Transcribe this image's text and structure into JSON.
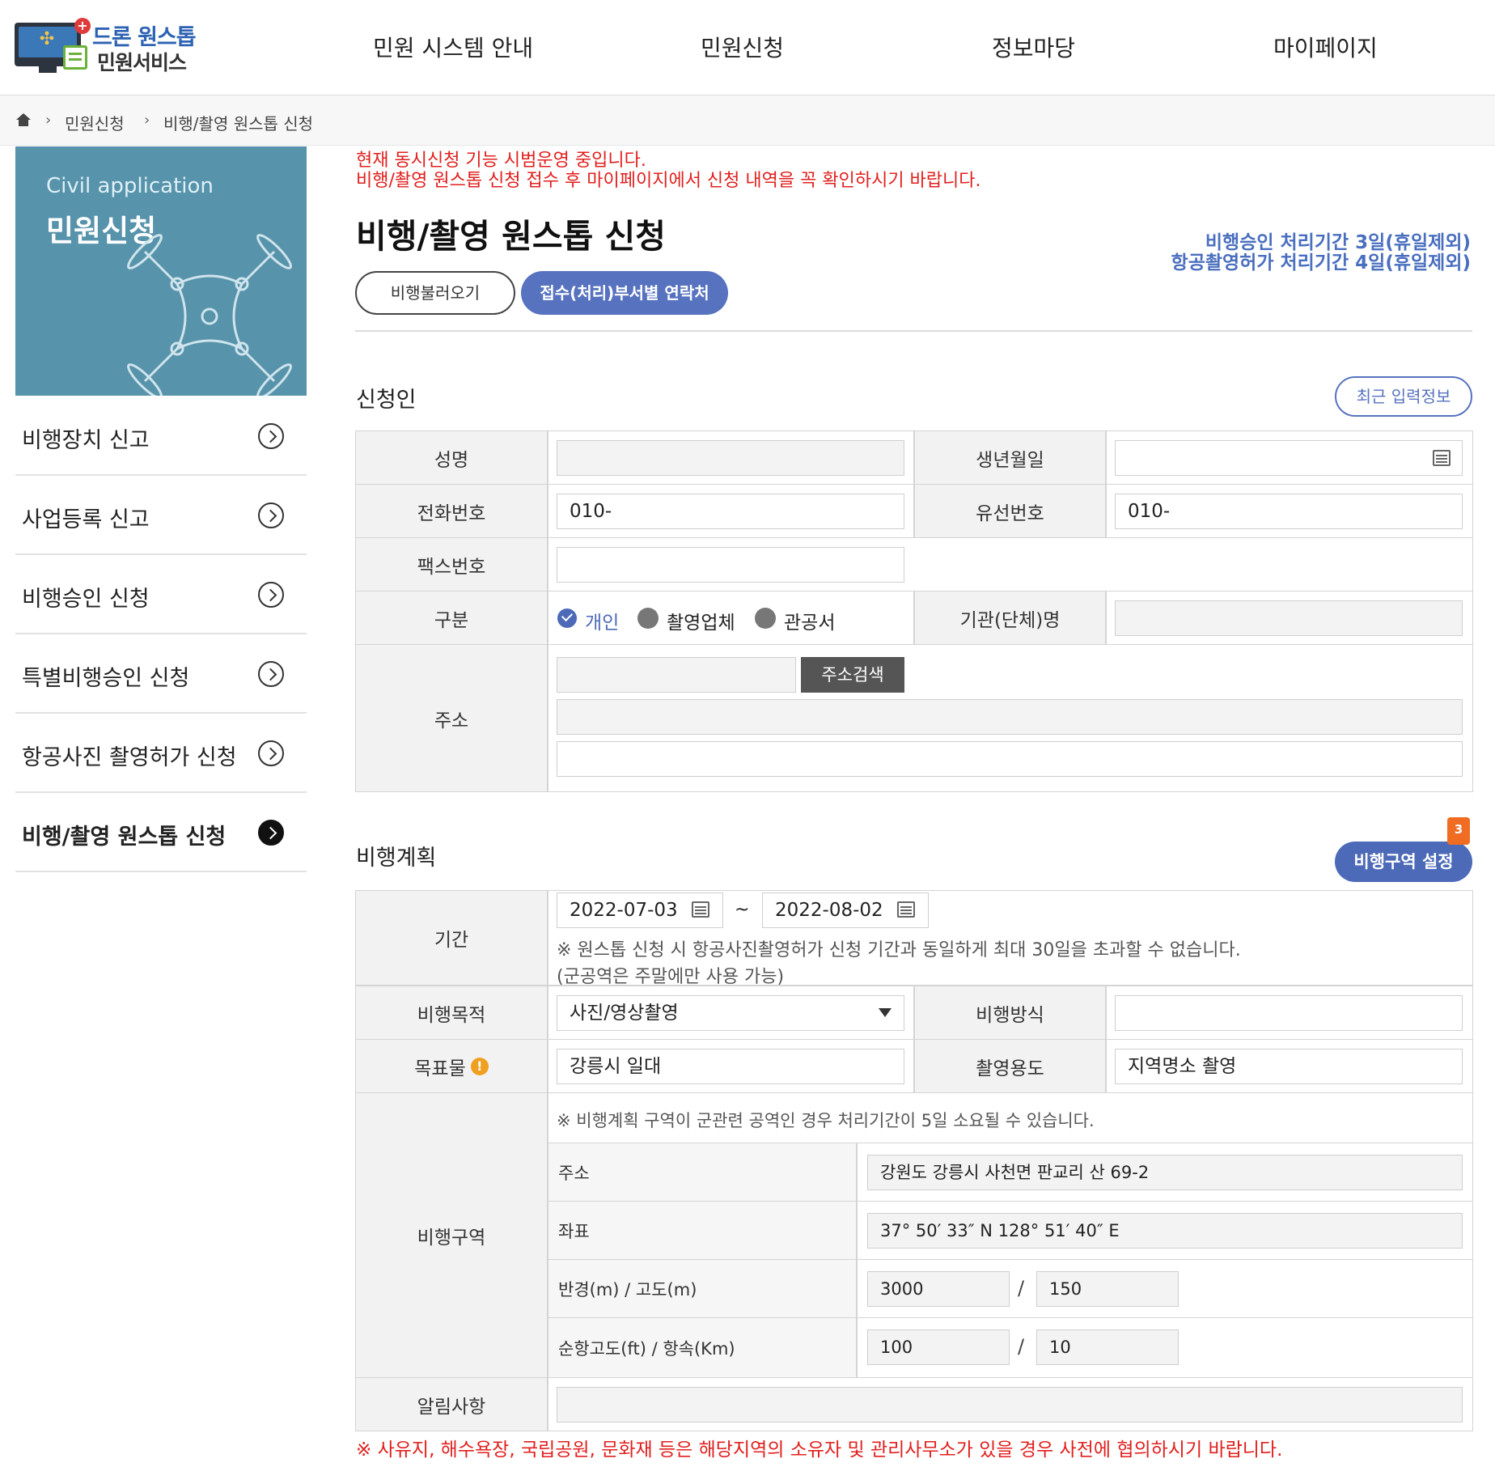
{
  "header": {
    "logo_line1": "드론 원스톱",
    "logo_line2": "민원서비스",
    "nav": [
      "민원 시스템 안내",
      "민원신청",
      "정보마당",
      "마이페이지"
    ]
  },
  "breadcrumb": [
    "민원신청",
    "비행/촬영 원스톱 신청"
  ],
  "sidebar": {
    "banner_en": "Civil application",
    "banner_kr": "민원신청",
    "items": [
      {
        "label": "비행장치 신고"
      },
      {
        "label": "사업등록 신고"
      },
      {
        "label": "비행승인 신청"
      },
      {
        "label": "특별비행승인 신청"
      },
      {
        "label": "항공사진 촬영허가 신청"
      },
      {
        "label": "비행/촬영 원스톱 신청"
      }
    ]
  },
  "notices": [
    "현재 동시신청 기능 시범운영 중입니다.",
    "비행/촬영 원스톱 신청 접수 후 마이페이지에서 신청 내역을 꼭 확인하시기 바랍니다."
  ],
  "page": {
    "title": "비행/촬영 원스톱 신청",
    "proc1": "비행승인 처리기간 3일(휴일제외)",
    "proc2": "항공촬영허가 처리기간 4일(휴일제외)",
    "btn_load": "비행불러오기",
    "btn_contact": "접수(처리)부서별 연락처"
  },
  "applicant": {
    "section": "신청인",
    "recent_btn": "최근 입력정보",
    "labels": {
      "name": "성명",
      "birth": "생년월일",
      "phone": "전화번호",
      "landline": "유선번호",
      "fax": "팩스번호",
      "type": "구분",
      "org": "기관(단체)명",
      "address": "주소"
    },
    "values": {
      "name": "",
      "birth": "",
      "phone": "010-",
      "landline": "010-",
      "fax": "",
      "org": ""
    },
    "type_options": [
      "개인",
      "촬영업체",
      "관공서"
    ],
    "type_selected": "개인",
    "address_search_btn": "주소검색"
  },
  "plan": {
    "section": "비행계획",
    "zone_btn": "비행구역 설정",
    "zone_count": "3",
    "labels": {
      "period": "기간",
      "purpose": "비행목적",
      "method": "비행방식",
      "target": "목표물",
      "usage": "촬영용도",
      "zone": "비행구역",
      "notice": "알림사항"
    },
    "period_start": "2022-07-03",
    "period_tilde": "~",
    "period_end": "2022-08-02",
    "period_note1": "※ 원스톱 신청 시 항공사진촬영허가 신청 기간과 동일하게 최대 30일을 초과할 수 없습니다.",
    "period_note2": "(군공역은 주말에만 사용 가능)",
    "purpose_value": "사진/영상촬영",
    "method_value": "",
    "target_value": "강릉시 일대",
    "usage_value": "지역명소 촬영",
    "zone_note": "※ 비행계획 구역이 군관련 공역인 경우 처리기간이 5일 소요될 수 있습니다.",
    "zone_rows": {
      "address_label": "주소",
      "address_value": "강원도 강릉시 사천면 판교리 산 69-2",
      "coord_label": "좌표",
      "coord_value": "37° 50′ 33″ N 128° 51′ 40″ E",
      "radius_label": "반경(m) / 고도(m)",
      "radius_value": "3000",
      "altitude_value": "150",
      "cruise_label": "순항고도(ft) / 항속(Km)",
      "cruise_alt_value": "100",
      "speed_value": "10",
      "slash": "/"
    },
    "notice_value": "",
    "bottom_warning": "※ 사유지, 해수욕장, 국립공원, 문화재 등은 해당지역의 소유자 및 관리사무소가 있을 경우 사전에 협의하시기 바랍니다."
  }
}
